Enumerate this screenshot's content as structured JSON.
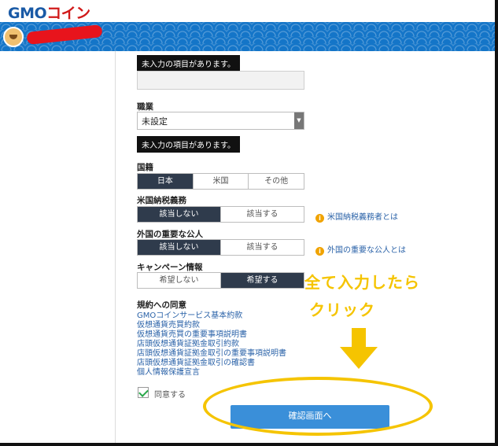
{
  "header": {
    "logo_main": "GMO",
    "logo_coin": "コイン"
  },
  "form": {
    "tooltip_incomplete_1": "未入力の項目があります。",
    "occupation": {
      "label": "職業",
      "value": "未設定",
      "tooltip": "未入力の項目があります。"
    },
    "nationality": {
      "label": "国籍",
      "options": [
        "日本",
        "米国",
        "その他"
      ],
      "selected": "日本"
    },
    "us_tax": {
      "label": "米国納税義務",
      "options": [
        "該当しない",
        "該当する"
      ],
      "selected": "該当しない",
      "info": "米国納税義務者とは"
    },
    "foreign_pep": {
      "label": "外国の重要な公人",
      "options": [
        "該当しない",
        "該当する"
      ],
      "selected": "該当しない",
      "info": "外国の重要な公人とは"
    },
    "campaign": {
      "label": "キャンペーン情報",
      "options": [
        "希望しない",
        "希望する"
      ],
      "selected": "希望する"
    },
    "terms": {
      "label": "規約への同意",
      "links": [
        "GMOコインサービス基本約款",
        "仮想通貨売買約款",
        "仮想通貨売買の重要事項説明書",
        "店頭仮想通貨証拠金取引約款",
        "店頭仮想通貨証拠金取引の重要事項説明書",
        "店頭仮想通貨証拠金取引の確認書",
        "個人情報保護宣言"
      ],
      "agree_label": "同意する"
    },
    "confirm_button": "確認画面へ"
  },
  "annotation": {
    "line1": "全て入力したら",
    "line2": "クリック"
  },
  "colors": {
    "brand_blue": "#1475c8",
    "selected_dark": "#2f3b4c",
    "confirm_blue": "#3a8fd9",
    "annotation_yellow": "#f5c400",
    "info_orange": "#f0a300"
  }
}
